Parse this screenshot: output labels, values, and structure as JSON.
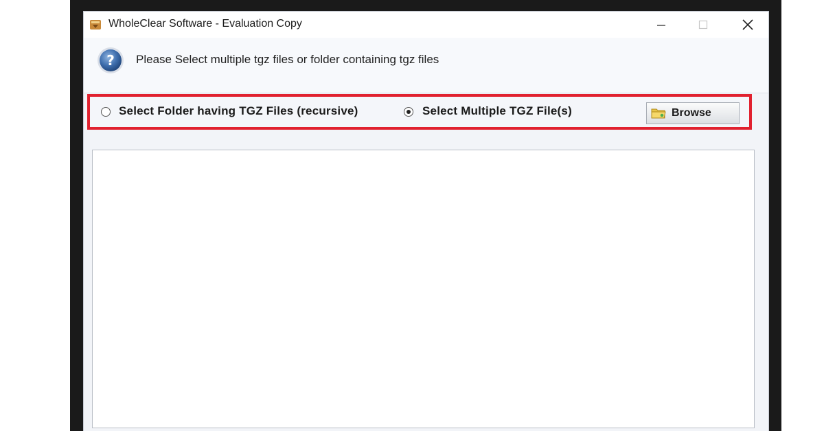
{
  "window": {
    "title": "WholeClear Software - Evaluation Copy",
    "controls": {
      "minimize_icon": "minimize-icon",
      "maximize_icon": "maximize-icon",
      "close_icon": "close-icon"
    }
  },
  "header": {
    "icon": "help-icon",
    "text": "Please Select multiple tgz files or folder containing tgz files"
  },
  "options": {
    "folder_option": {
      "label": "Select Folder having TGZ Files (recursive)",
      "selected": false
    },
    "files_option": {
      "label": "Select Multiple TGZ File(s)",
      "selected": true
    },
    "browse_button": {
      "label": "Browse",
      "icon": "folder-icon"
    },
    "highlight_color": "#e1212f"
  },
  "file_list": {
    "items": []
  }
}
